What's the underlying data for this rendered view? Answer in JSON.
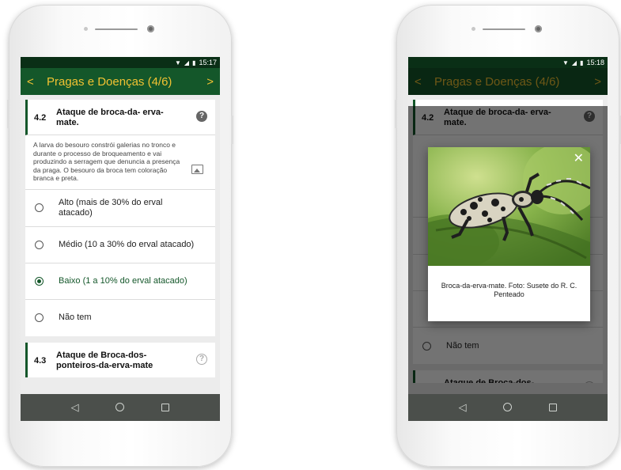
{
  "statusbar_left": {
    "time": "15:17"
  },
  "statusbar_right": {
    "time": "15:18"
  },
  "appbar": {
    "back": "<",
    "title": "Pragas e Doenças",
    "count": "(4/6)",
    "forward": ">"
  },
  "q42": {
    "number": "4.2",
    "title": "Ataque de broca-da- erva-mate.",
    "description": "A larva do besouro constrói galerias no tronco e durante o processo de broqueamento e vai produzindo a serragem que denuncia a presença da praga. O besouro da broca tem coloração branca e preta.",
    "options": [
      {
        "label": "Alto (mais de 30% do erval atacado)",
        "selected": false
      },
      {
        "label": "Médio (10 a 30% do erval atacado)",
        "selected": false
      },
      {
        "label": "Baixo (1 a 10% do erval atacado)",
        "selected": true
      },
      {
        "label": "Não tem",
        "selected": false
      }
    ]
  },
  "q43": {
    "number": "4.3",
    "title": "Ataque de Broca-dos-ponteiros-da-erva-mate"
  },
  "modal": {
    "caption": "Broca-da-erva-mate. Foto: Susete do R. C. Penteado",
    "close": "✕"
  },
  "icons": {
    "help": "question-circle-icon",
    "image": "image-icon",
    "close": "close-icon"
  },
  "colors": {
    "primary": "#14572a",
    "accent": "#f1c232",
    "statusbar": "#0a2f16",
    "navbar": "#4b4f4b"
  }
}
